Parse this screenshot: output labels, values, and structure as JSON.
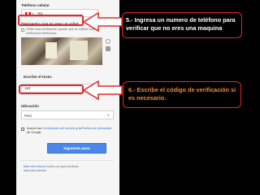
{
  "form": {
    "phone_label": "Teléfono celular",
    "phone_code": "+51",
    "robot_label": "Demuestra que no eres un robot",
    "skip_text": "Omitir esta verificación (puede que se solicite una verificación telefónica)",
    "captcha_label": "Escribe el texto:",
    "captcha_value": "110",
    "location_label": "Ubicación",
    "location_value": "Perú",
    "terms_prefix": "Acepto las ",
    "terms_link1": "Condiciones del servicio",
    "terms_mid": " y la ",
    "terms_link2": "Política de privacidad",
    "terms_suffix": " de Google.",
    "next_button": "Siguiente paso",
    "more_info_link": "Más información",
    "more_info_rest": " sobre por qué pedimos esta información."
  },
  "annotations": {
    "step5": "5.- Ingresa un numero de teléfono para verificar que no eres una maquina",
    "step6": "6.- Escribe el código de verificación si es necesario."
  },
  "colors": {
    "highlight": "#e3282b",
    "step6_text": "#f28a2b",
    "button": "#4a87e8"
  }
}
